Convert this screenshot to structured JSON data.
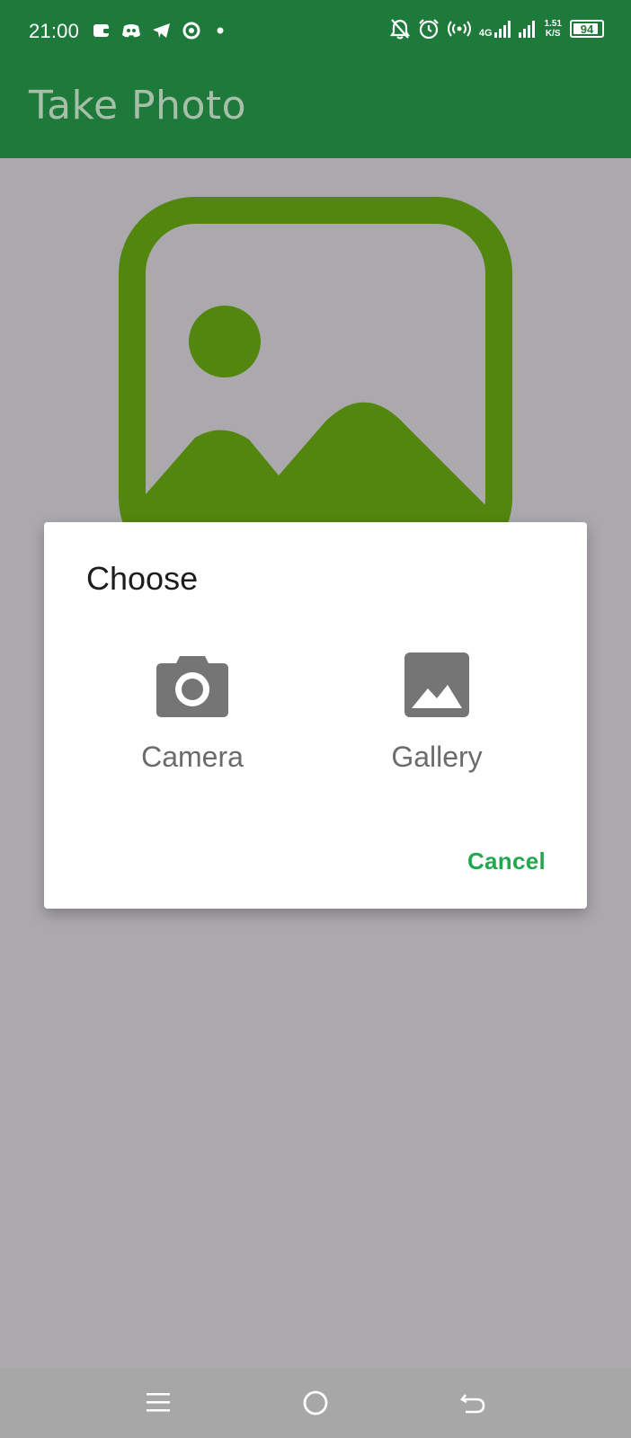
{
  "status_bar": {
    "time": "21:00",
    "network": "4G",
    "net_speed_value": "1.51",
    "net_speed_unit": "K/S",
    "battery": "94"
  },
  "app_bar": {
    "title": "Take Photo"
  },
  "dialog": {
    "title": "Choose",
    "options": [
      {
        "label": "Camera",
        "icon": "camera-icon"
      },
      {
        "label": "Gallery",
        "icon": "gallery-icon"
      }
    ],
    "cancel_label": "Cancel"
  },
  "nav_bar": {
    "buttons": [
      "menu-icon",
      "home-icon",
      "back-icon"
    ]
  },
  "colors": {
    "app_bar": "#1e7a3b",
    "accent": "#22a94f",
    "placeholder_icon": "#53860f",
    "scrim_background": "#aca9ae",
    "dialog_icon": "#757575"
  }
}
